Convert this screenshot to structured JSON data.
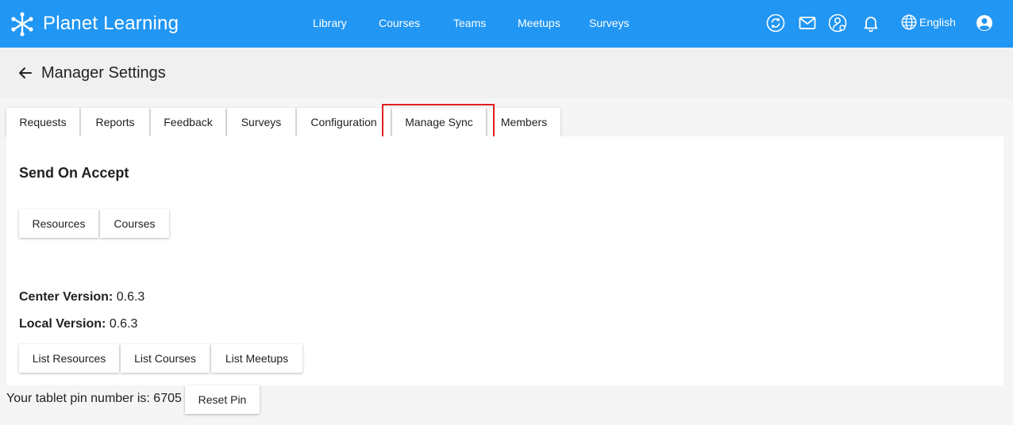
{
  "app": {
    "name": "Planet Learning"
  },
  "nav": {
    "items": [
      "Library",
      "Courses",
      "Teams",
      "Meetups",
      "Surveys"
    ]
  },
  "header_icons": [
    "sync-icon",
    "mail-icon",
    "user-settings-icon",
    "bell-icon",
    "globe-icon",
    "account-icon"
  ],
  "language": {
    "label": "English"
  },
  "page": {
    "title": "Manager Settings"
  },
  "tabs": [
    "Requests",
    "Reports",
    "Feedback",
    "Surveys",
    "Configuration",
    "Manage Sync",
    "Members"
  ],
  "active_tab": "Manage Sync",
  "send_on_accept": {
    "title": "Send On Accept",
    "buttons": [
      "Resources",
      "Courses"
    ]
  },
  "versions": {
    "center_label": "Center Version:",
    "center_value": "0.6.3",
    "local_label": "Local Version:",
    "local_value": "0.6.3"
  },
  "list_buttons": [
    "List Resources",
    "List Courses",
    "List Meetups"
  ],
  "pin": {
    "text": "Your tablet pin number is: 6705",
    "reset_label": "Reset Pin"
  },
  "colors": {
    "toolbar": "#2196f3",
    "highlight": "#e02020"
  }
}
